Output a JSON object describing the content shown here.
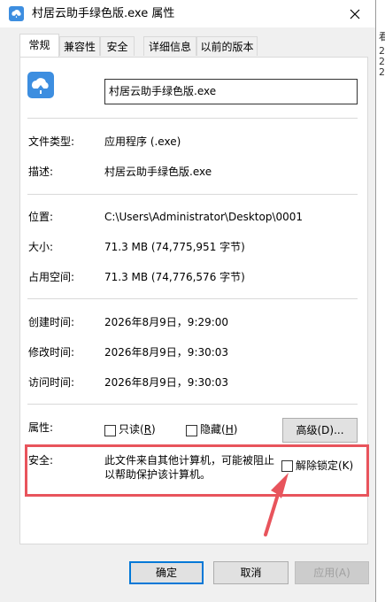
{
  "window": {
    "title": "村居云助手绿色版.exe 属性",
    "file_name": "村居云助手绿色版.exe"
  },
  "tabs": [
    {
      "label": "常规",
      "active": true
    },
    {
      "label": "兼容性",
      "active": false
    },
    {
      "label": "安全",
      "active": false
    },
    {
      "label": "详细信息",
      "active": false
    },
    {
      "label": "以前的版本",
      "active": false
    }
  ],
  "general": {
    "file_type_label": "文件类型:",
    "file_type_value": "应用程序 (.exe)",
    "description_label": "描述:",
    "description_value": "村居云助手绿色版.exe",
    "location_label": "位置:",
    "location_value": "C:\\Users\\Administrator\\Desktop\\0001",
    "size_label": "大小:",
    "size_value": "71.3 MB (74,775,951 字节)",
    "size_on_disk_label": "占用空间:",
    "size_on_disk_value": "71.3 MB (74,776,576 字节)",
    "created_label": "创建时间:",
    "created_value": "2026年8月9日，9:29:00",
    "modified_label": "修改时间:",
    "modified_value": "2026年8月9日，9:30:03",
    "accessed_label": "访问时间:",
    "accessed_value": "2026年8月9日，9:30:03"
  },
  "attributes": {
    "label": "属性:",
    "readonly": {
      "text": "只读",
      "key": "(R)",
      "key_letter": "R",
      "checked": false
    },
    "hidden": {
      "text": "隐藏",
      "key": "(H)",
      "key_letter": "H",
      "checked": false
    },
    "advanced_button": "高级(D)..."
  },
  "security": {
    "label": "安全:",
    "message_line1": "此文件来自其他计算机，可能被阻止",
    "message_line2": "以帮助保护该计算机。",
    "unblock": {
      "text": "解除锁定(K)",
      "checked": false
    }
  },
  "buttons": {
    "ok": "确定",
    "cancel": "取消",
    "apply": "应用(A)"
  },
  "background_window": {
    "lines": [
      "看",
      "2",
      "2",
      "2"
    ]
  },
  "colors": {
    "annotation_red": "#e8545c",
    "focus_blue": "#0078d7",
    "icon_blue": "#3d8ee0"
  },
  "icons": {
    "title_icon": "cloud-house-icon",
    "file_icon": "cloud-house-icon",
    "close_icon": "close-icon"
  }
}
